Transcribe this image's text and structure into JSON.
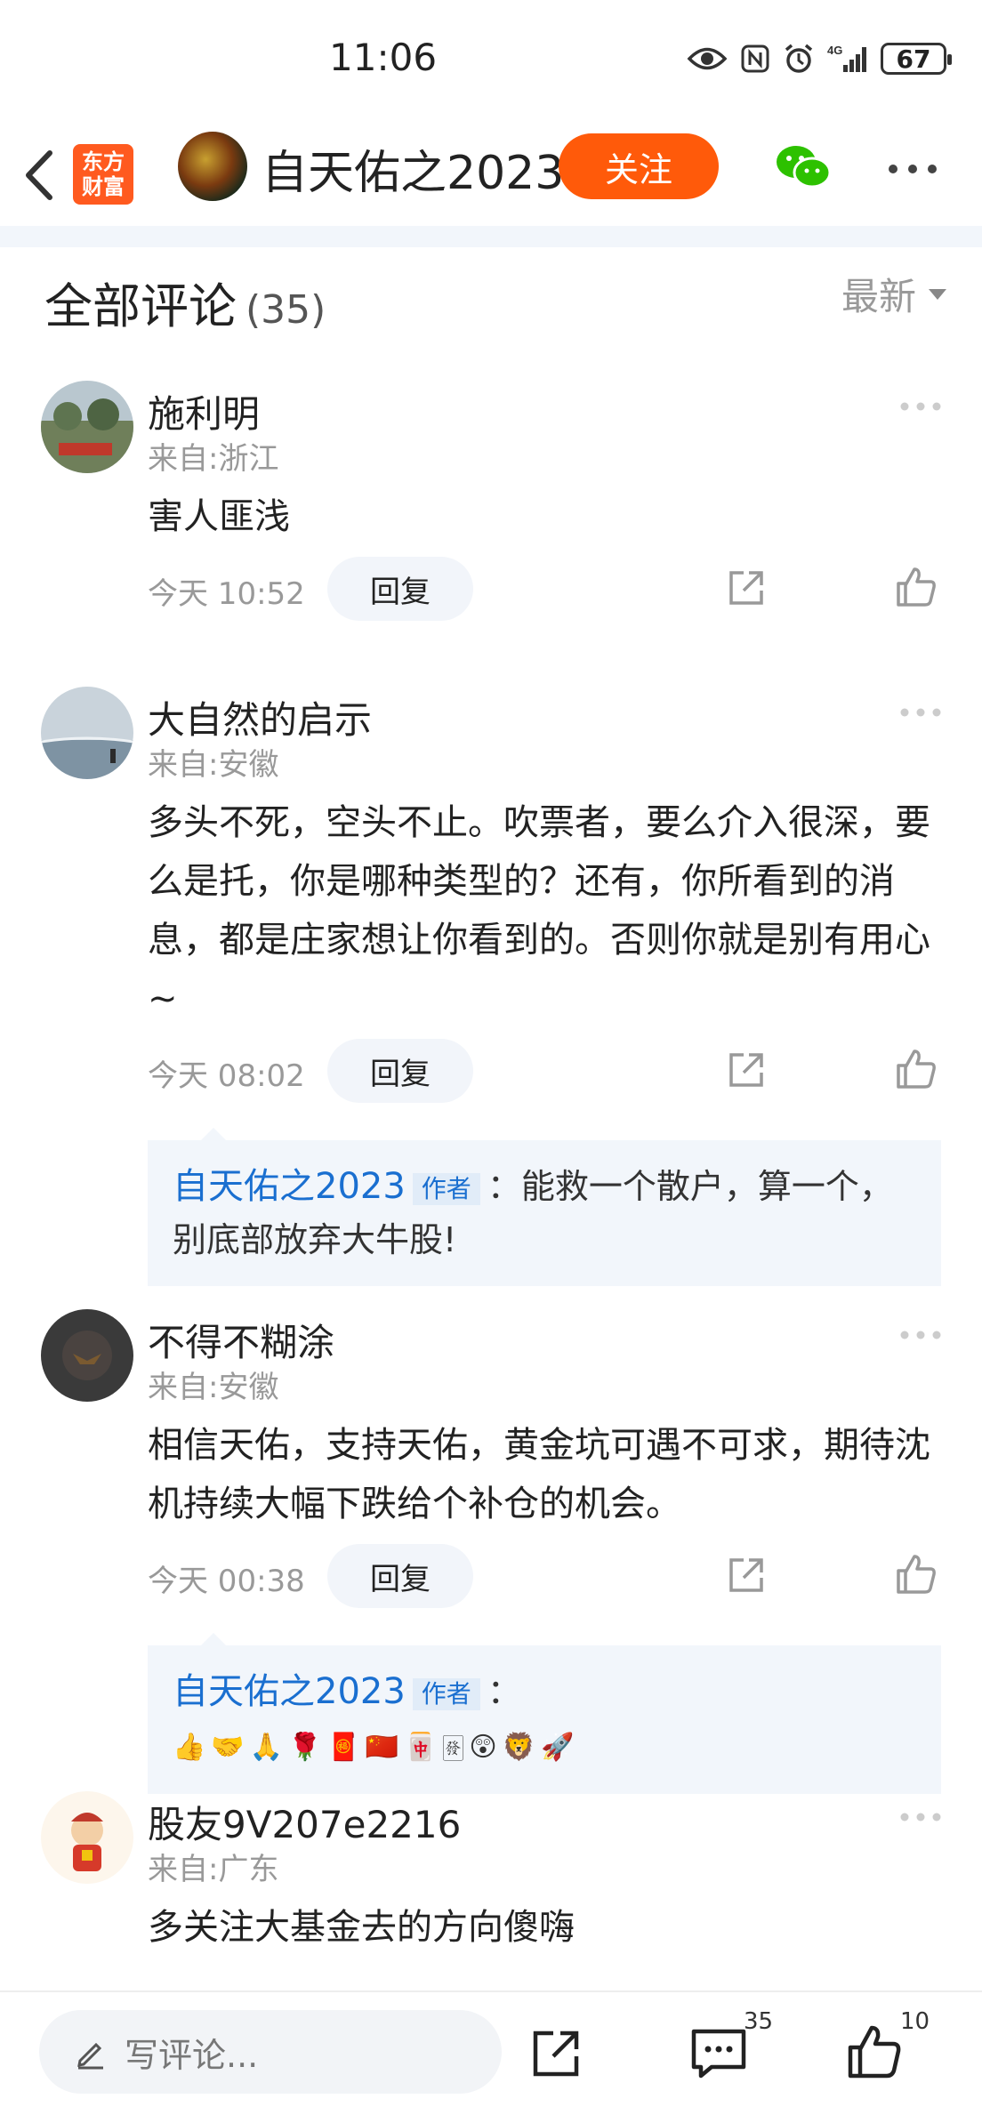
{
  "status": {
    "time": "11:06",
    "battery": "67",
    "network": "4G"
  },
  "header": {
    "logo_line1": "东方",
    "logo_line2": "财富",
    "author_name": "自天佑之2023",
    "follow_label": "关注"
  },
  "comments_section": {
    "title": "全部评论",
    "count": "(35)",
    "sort_label": "最新"
  },
  "comments": [
    {
      "name": "施利明",
      "location": "来自:浙江",
      "text": "害人匪浅",
      "time": "今天 10:52",
      "reply_label": "回复"
    },
    {
      "name": "大自然的启示",
      "location": "来自:安徽",
      "text": "多头不死，空头不止。吹票者，要么介入很深，要么是托，你是哪种类型的？还有，你所看到的消息，都是庄家想让你看到的。否则你就是别有用心~",
      "time": "今天 08:02",
      "reply_label": "回复",
      "reply": {
        "author": "自天佑之2023",
        "tag": "作者",
        "text": "：能救一个散户，算一个，别底部放弃大牛股!"
      }
    },
    {
      "name": "不得不糊涂",
      "location": "来自:安徽",
      "text": "相信天佑，支持天佑，黄金坑可遇不可求，期待沈机持续大幅下跌给个补仓的机会。",
      "time": "今天 00:38",
      "reply_label": "回复",
      "reply": {
        "author": "自天佑之2023",
        "tag": "作者",
        "text": "：",
        "emojis": [
          "👍",
          "🤝",
          "🙏",
          "🌹",
          "🧧",
          "🇨🇳",
          "🀄",
          "🀅",
          "😲",
          "🦁",
          "🚀"
        ]
      }
    },
    {
      "name": "股友9V207e2216",
      "location": "来自:广东",
      "text": "多关注大基金去的方向傻嗨"
    }
  ],
  "bottom_bar": {
    "input_placeholder": "写评论...",
    "comment_count": "35",
    "like_count": "10"
  },
  "colors": {
    "accent": "#ff5a0a",
    "link_blue": "#1a6fd0",
    "reply_bg": "#f2f6fb"
  }
}
